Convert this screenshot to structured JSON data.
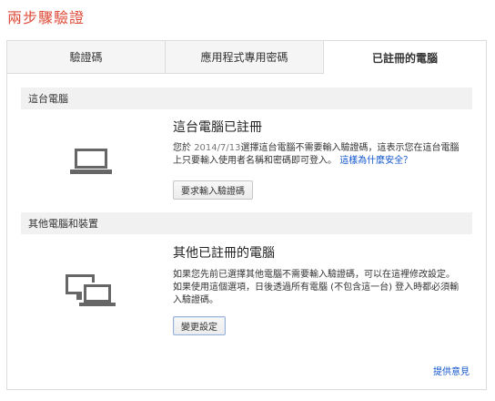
{
  "page": {
    "title": "兩步驟驗證"
  },
  "tabs": [
    {
      "label": "驗證碼"
    },
    {
      "label": "應用程式專用密碼"
    },
    {
      "label": "已註冊的電腦"
    }
  ],
  "this_computer": {
    "section_label": "這台電腦",
    "icon": "laptop-icon",
    "heading": "這台電腦已註冊",
    "desc_line1_pre": "您於 ",
    "desc_date": "2014/7/13",
    "desc_line1_post": "選擇這台電腦不需要輸入驗證碼，這表示您在這台電腦",
    "desc_line2": "上只要輸入使用者名稱和密碼即可登入。",
    "why_safe_link": "這樣為什麼安全？",
    "button_label": "要求輸入驗證碼"
  },
  "other_computers": {
    "section_label": "其他電腦和裝置",
    "icon": "multiple-devices-icon",
    "heading": "其他已註冊的電腦",
    "desc_line1": "如果您先前已選擇其他電腦不需要輸入驗證碼，可以在這裡修改設定。",
    "desc_line2": "如果使用這個選項，日後透過所有電腦 (不包含這一台) 登入時都必須輸",
    "desc_line3": "入驗證碼。",
    "button_label": "變更設定"
  },
  "footer": {
    "feedback_link": "提供意見"
  },
  "colors": {
    "title": "#dd4b39",
    "link": "#1155cc",
    "section_bar": "#f1f1f1",
    "icon": "#666666"
  }
}
